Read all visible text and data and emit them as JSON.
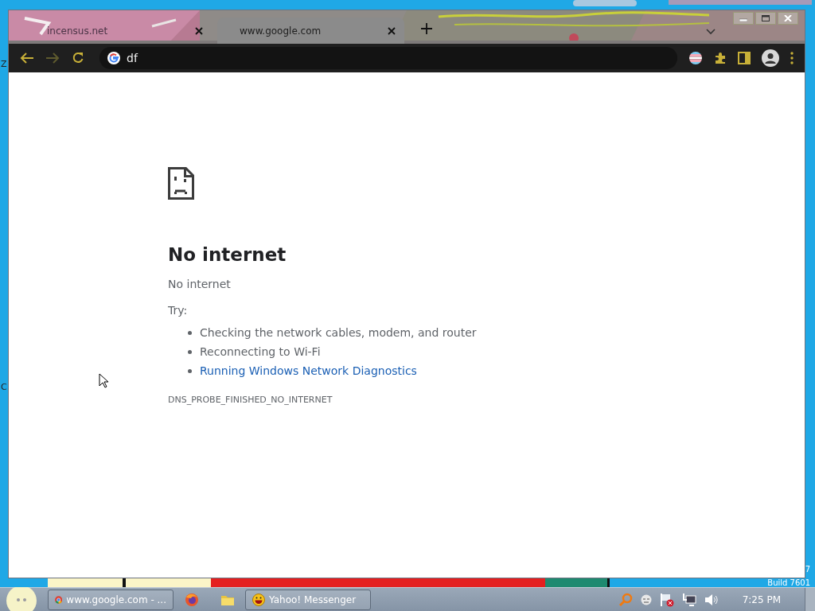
{
  "desktop": {
    "edge_letters": [
      "Z",
      "C"
    ],
    "corner_text": [
      "7",
      "Build 7601"
    ]
  },
  "browser": {
    "tabs": [
      {
        "title": "incensus.net",
        "selected": false
      },
      {
        "title": "www.google.com",
        "selected": true
      }
    ],
    "nav": {
      "back_disabled": false,
      "forward_disabled": true
    },
    "address": "df",
    "error_page": {
      "heading": "No internet",
      "subtitle": "No internet",
      "try_label": "Try:",
      "suggestions": [
        {
          "kind": "plain",
          "text": "Checking the network cables, modem, and router"
        },
        {
          "kind": "plain",
          "text": "Reconnecting to Wi-Fi"
        },
        {
          "kind": "link",
          "text": "Running Windows Network Diagnostics"
        }
      ],
      "error_code": "DNS_PROBE_FINISHED_NO_INTERNET"
    }
  },
  "taskbar": {
    "items": [
      {
        "kind": "button",
        "label": "www.google.com - ..."
      },
      {
        "kind": "icon"
      },
      {
        "kind": "icon"
      },
      {
        "kind": "button",
        "label": "Yahoo! Messenger"
      }
    ],
    "clock": "7:25 PM"
  }
}
